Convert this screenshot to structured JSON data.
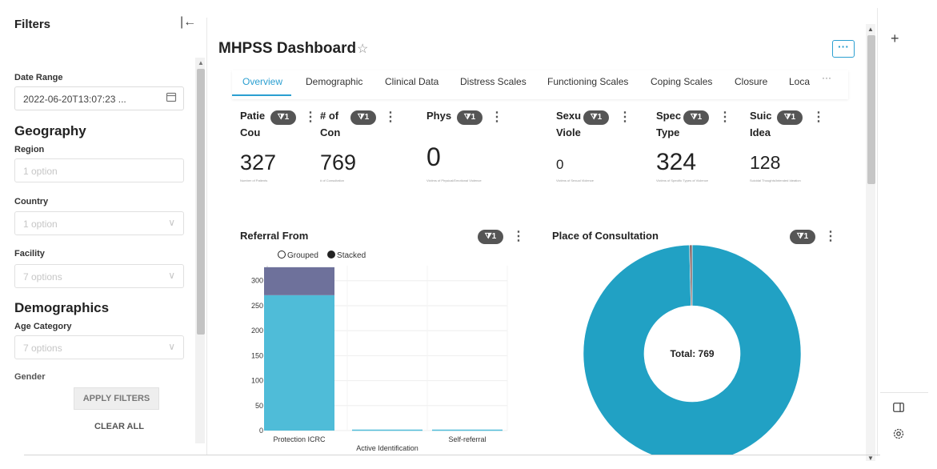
{
  "filters": {
    "title": "Filters",
    "collapse_icon": "collapse-left-icon",
    "date_range": {
      "label": "Date Range",
      "value": "2022-06-20T13:07:23 ..."
    },
    "geography_heading": "Geography",
    "region": {
      "label": "Region",
      "placeholder": "1 option"
    },
    "country": {
      "label": "Country",
      "placeholder": "1 option"
    },
    "facility": {
      "label": "Facility",
      "placeholder": "7 options"
    },
    "demographics_heading": "Demographics",
    "age_category": {
      "label": "Age Category",
      "placeholder": "7 options"
    },
    "gender": {
      "label": "Gender"
    },
    "apply_label": "APPLY FILTERS",
    "clear_label": "CLEAR ALL"
  },
  "dashboard": {
    "title": "MHPSS Dashboard",
    "more_label": "···",
    "tabs": [
      {
        "label": "Overview",
        "active": true
      },
      {
        "label": "Demographic"
      },
      {
        "label": "Clinical Data"
      },
      {
        "label": "Distress Scales"
      },
      {
        "label": "Functioning Scales"
      },
      {
        "label": "Coping Scales"
      },
      {
        "label": "Closure"
      },
      {
        "label": "Loca"
      }
    ],
    "tab_more": "···",
    "filter_badge": "⧩1",
    "kpis": [
      {
        "title1": "Patie",
        "title2": "Cou",
        "value": "327",
        "sub": "Number of Patients"
      },
      {
        "title1": "# of",
        "title2": "Con",
        "value": "769",
        "sub": "# of Consultation"
      },
      {
        "title1": "Phys",
        "title2": "",
        "value": "0",
        "sub": "Victims of Physical/Emotional Violence"
      },
      {
        "title1": "Sexu",
        "title2": "Viole",
        "value": "0",
        "sub": "Victims of Sexual Violence"
      },
      {
        "title1": "Spec",
        "title2": "Type",
        "value": "324",
        "sub": "Victims of Specific Types of Violence"
      },
      {
        "title1": "Suic",
        "title2": "Idea",
        "value": "128",
        "sub": "Suicidal Thoughts/Intended Ideation"
      }
    ]
  },
  "chart_data": [
    {
      "type": "bar",
      "title": "Referral From",
      "legend": [
        "Grouped",
        "Stacked"
      ],
      "legend_selected": "Stacked",
      "categories": [
        "Protection ICRC",
        "Active Identification",
        "Self-referral"
      ],
      "series": [
        {
          "values": [
            271,
            2,
            2
          ],
          "color": "#4fbcd8"
        },
        {
          "values": [
            56,
            0,
            0
          ],
          "color": "#6e719b"
        }
      ],
      "yticks": [
        "0",
        "50",
        "100",
        "150",
        "200",
        "250",
        "300"
      ],
      "ylim": [
        0,
        330
      ]
    },
    {
      "type": "pie",
      "title": "Place of Consultation",
      "center_label": "Total: 769",
      "slices": [
        {
          "value": 766,
          "color": "#21a1c4"
        },
        {
          "value": 3,
          "color": "#8a6a6a"
        }
      ]
    }
  ],
  "colors": {
    "accent": "#2b9fd1",
    "badge": "#555555"
  },
  "rail": {
    "plus_icon": "+"
  }
}
